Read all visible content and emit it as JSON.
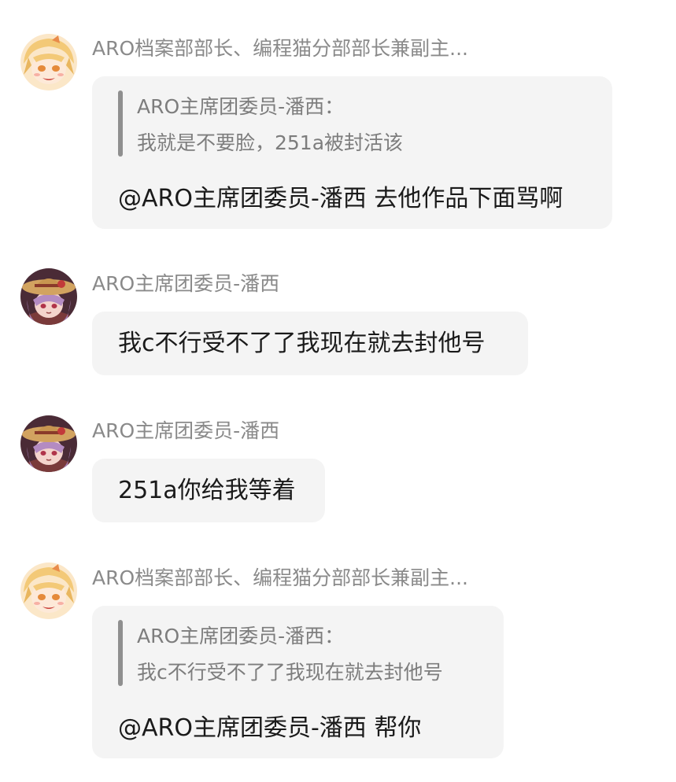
{
  "messages": [
    {
      "sender": "ARO档案部部长、编程猫分部部长兼副主...",
      "avatar_icon": "blonde-anime-girl-avatar-icon",
      "quote": {
        "author": "ARO主席团委员-潘西：",
        "text": "我就是不要脸，251a被封活该"
      },
      "text": "@ARO主席团委员-潘西 去他作品下面骂啊"
    },
    {
      "sender": "ARO主席团委员-潘西",
      "avatar_icon": "purple-hair-hat-anime-girl-avatar-icon",
      "text": "我c不行受不了了我现在就去封他号"
    },
    {
      "sender": "ARO主席团委员-潘西",
      "avatar_icon": "purple-hair-hat-anime-girl-avatar-icon",
      "text": "251a你给我等着"
    },
    {
      "sender": "ARO档案部部长、编程猫分部部长兼副主...",
      "avatar_icon": "blonde-anime-girl-avatar-icon",
      "quote": {
        "author": "ARO主席团委员-潘西：",
        "text": "我c不行受不了了我现在就去封他号"
      },
      "text": "@ARO主席团委员-潘西 帮你"
    }
  ],
  "colors": {
    "bubble_bg": "#f4f4f4",
    "sender_text": "#8a8a8a",
    "message_text": "#1a1a1a",
    "quote_text": "#7d7d7d",
    "quote_bar": "#8f8f8f"
  }
}
